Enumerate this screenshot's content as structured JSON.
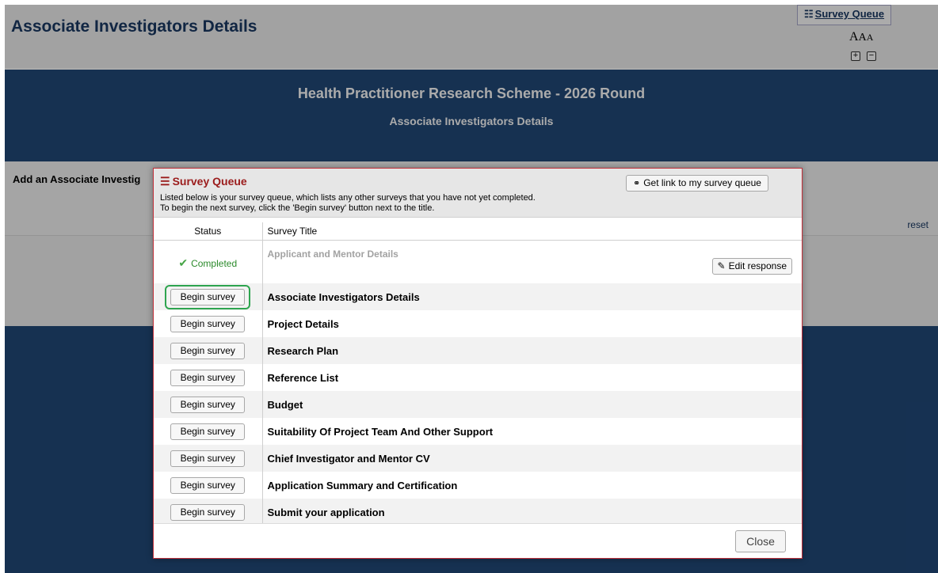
{
  "header": {
    "title": "Associate Investigators Details",
    "survey_queue_link": "Survey Queue",
    "text_size": [
      "A",
      "A",
      "A"
    ]
  },
  "banner": {
    "title": "Health Practitioner Research Scheme - 2026 Round",
    "subtitle": "Associate Investigators Details"
  },
  "form": {
    "add_label": "Add an Associate Investig",
    "reset_label": "reset"
  },
  "dialog": {
    "title": "Survey Queue",
    "line1": "Listed below is your survey queue, which lists any other surveys that you have not yet completed.",
    "line2": "To begin the next survey, click the 'Begin survey' button next to the title.",
    "get_link_label": "Get link to my survey queue",
    "columns": {
      "status": "Status",
      "title": "Survey Title"
    },
    "completed_row": {
      "status": "Completed",
      "title": "Applicant and Mentor Details",
      "edit_label": "Edit response"
    },
    "begin_label": "Begin survey",
    "rows": [
      "Associate Investigators Details",
      "Project Details",
      "Research Plan",
      "Reference List",
      "Budget",
      "Suitability Of Project Team And Other Support",
      "Chief Investigator and Mentor CV",
      "Application Summary and Certification",
      "Submit your application"
    ],
    "close_label": "Close"
  },
  "colors": {
    "banner": "#21497a",
    "dialog_title": "#9b1c1c",
    "completed": "#2b8a2b",
    "highlight": "#2ea44f"
  }
}
